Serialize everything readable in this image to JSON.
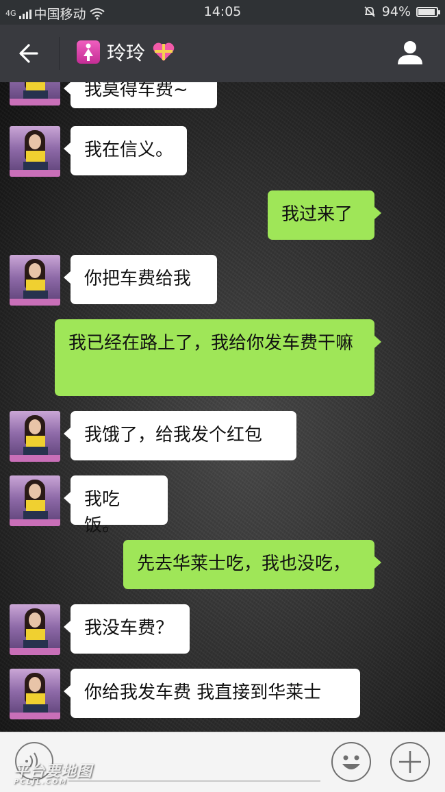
{
  "status_bar": {
    "network": "4G",
    "carrier": "中国移动",
    "time": "14:05",
    "battery": "94%",
    "battery_level": 0.94
  },
  "header": {
    "title": "玲玲",
    "icons": [
      "back-arrow-icon",
      "female-icon",
      "heart-gift-icon",
      "profile-icon"
    ]
  },
  "messages": [
    {
      "side": "in",
      "text": "我莫得车费~"
    },
    {
      "side": "in",
      "text": "我在信义。"
    },
    {
      "side": "out",
      "text": "我过来了"
    },
    {
      "side": "in",
      "text": "你把车费给我"
    },
    {
      "side": "out",
      "text": "我已经在路上了，我给你发车费干嘛"
    },
    {
      "side": "in",
      "text": "我饿了，给我发个红包"
    },
    {
      "side": "in",
      "text": "我吃饭。"
    },
    {
      "side": "out",
      "text": "先去华莱士吃，我也没吃，"
    },
    {
      "side": "in",
      "text": "我没车费？"
    },
    {
      "side": "in",
      "text": "你给我发车费 我直接到华莱士"
    }
  ],
  "colors": {
    "outgoing_bubble": "#9fe658",
    "incoming_bubble": "#ffffff",
    "header_bg": "#393a3f",
    "status_bg": "#2f3235"
  },
  "input_bar": {
    "icons": [
      "voice-icon",
      "emoji-icon",
      "plus-icon"
    ]
  },
  "watermark": {
    "text": "平台要地图",
    "sub": "PCLJL.COM"
  }
}
